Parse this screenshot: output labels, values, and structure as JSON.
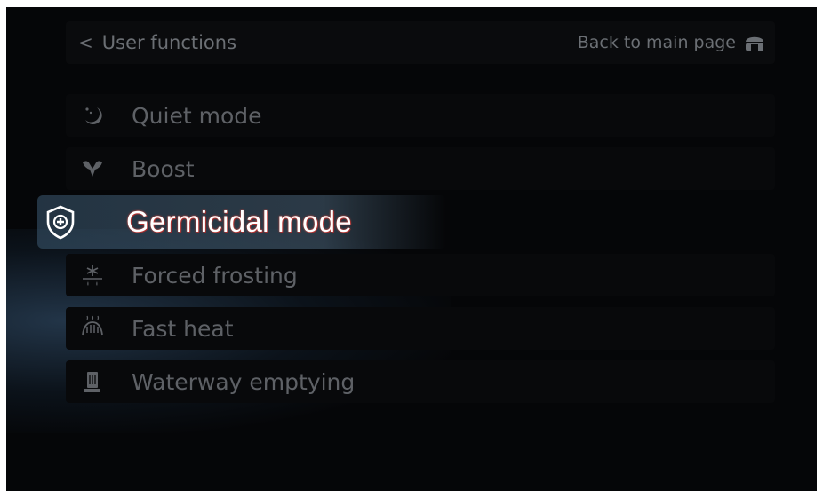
{
  "header": {
    "back_label": "User functions",
    "main_page_label": "Back to main page",
    "main_page_icon": "home-icon"
  },
  "menu": {
    "items": [
      {
        "label": "Quiet mode",
        "icon": "moon-stars-icon",
        "selected": false
      },
      {
        "label": "Boost",
        "icon": "boost-icon",
        "selected": false
      },
      {
        "label": "Germicidal mode",
        "icon": "shield-plus-icon",
        "selected": true
      },
      {
        "label": "Forced frosting",
        "icon": "snowflake-drop-icon",
        "selected": false
      },
      {
        "label": "Fast heat",
        "icon": "heater-waves-icon",
        "selected": false
      },
      {
        "label": "Waterway emptying",
        "icon": "water-tank-icon",
        "selected": false
      }
    ]
  },
  "colors": {
    "background": "#050608",
    "text_dim": "#5e6166",
    "text_selected": "#ffffff",
    "selection_band": "#4a6a85"
  }
}
